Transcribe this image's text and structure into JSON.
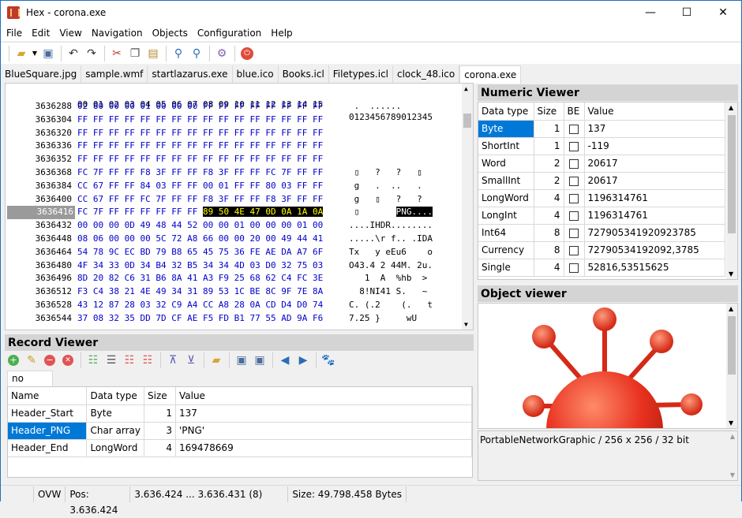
{
  "window": {
    "title": "Hex - corona.exe",
    "minimize": "—",
    "maximize": "☐",
    "close": "✕"
  },
  "menu": [
    "File",
    "Edit",
    "View",
    "Navigation",
    "Objects",
    "Configuration",
    "Help"
  ],
  "toolbar_icons": [
    "open-folder-icon",
    "dropdown-arrow-icon",
    "save-icon",
    "undo-icon",
    "redo-icon",
    "cut-icon",
    "copy-icon",
    "paste-icon",
    "find-icon",
    "find-next-icon",
    "settings-icon",
    "power-icon"
  ],
  "tabs": [
    "BlueSquare.jpg",
    "sample.wmf",
    "startlazarus.exe",
    "blue.ico",
    "Books.icl",
    "Filetypes.icl",
    "clock_48.ico",
    "corona.exe"
  ],
  "active_tab": "corona.exe",
  "hex": {
    "header_cols": "00 01 02 03 04 05 06 07 08 09 10 11 12 13 14 15",
    "header_ascii": "0123456789012345",
    "rows": [
      {
        "off": "3636288",
        "hex": "02 80 00 00 01 00 00 00 FF FF FF FF FF FF FF FF",
        "asc": " .  ......"
      },
      {
        "off": "3636304",
        "hex": "FF FF FF FF FF FF FF FF FF FF FF FF FF FF FF FF",
        "asc": ""
      },
      {
        "off": "3636320",
        "hex": "FF FF FF FF FF FF FF FF FF FF FF FF FF FF FF FF",
        "asc": ""
      },
      {
        "off": "3636336",
        "hex": "FF FF FF FF FF FF FF FF FF FF FF FF FF FF FF FF",
        "asc": ""
      },
      {
        "off": "3636352",
        "hex": "FF FF FF FF FF FF FF FF FF FF FF FF FF FF FF FF",
        "asc": ""
      },
      {
        "off": "3636368",
        "hex": "FC 7F FF FF F8 3F FF FF F8 3F FF FF FC 7F FF FF",
        "asc": " ▯   ?   ?   ▯"
      },
      {
        "off": "3636384",
        "hex": "CC 67 FF FF 84 03 FF FF 00 01 FF FF 80 03 FF FF",
        "asc": " g   .  ..   ."
      },
      {
        "off": "3636400",
        "hex": "CC 67 FF FF FC 7F FF FF F8 3F FF FF F8 3F FF FF",
        "asc": " g   ▯   ?   ?"
      },
      {
        "off": "3636416",
        "hex": "FC 7F FF FF FF FF FF FF 89 50 4E 47 0D 0A 1A 0A",
        "asc": " ▯       PNG....",
        "selected": true
      },
      {
        "off": "3636432",
        "hex": "00 00 00 0D 49 48 44 52 00 00 01 00 00 00 01 00",
        "asc": "....IHDR........"
      },
      {
        "off": "3636448",
        "hex": "08 06 00 00 00 5C 72 A8 66 00 00 20 00 49 44 41",
        "asc": ".....\\r f.. .IDA"
      },
      {
        "off": "3636464",
        "hex": "54 78 9C EC BD 79 B8 65 45 75 36 FE AE DA A7 6F",
        "asc": "Tx   y eEu6    o"
      },
      {
        "off": "3636480",
        "hex": "4F 34 33 0D 34 B4 32 B5 34 34 4D 03 D0 32 75 03",
        "asc": "O43.4 2 44M. 2u."
      },
      {
        "off": "3636496",
        "hex": "8D 20 82 C6 31 B6 8A 41 A3 F9 25 68 62 C4 FC 3E",
        "asc": "   1  A  %hb  >"
      },
      {
        "off": "3636512",
        "hex": "F3 C4 38 21 4E 49 34 31 89 53 1C BE 8C 9F 7E 8A",
        "asc": "  8!NI41 S.   ~"
      },
      {
        "off": "3636528",
        "hex": "43 12 87 28 03 32 C9 A4 CC A8 28 0A CD D4 D0 74",
        "asc": "C. (.2    (.   t"
      },
      {
        "off": "3636544",
        "hex": "37 08 32 35 DD 7D CF AE F5 FD B1 77 55 AD 9A F6",
        "asc": "7.25 }     wU"
      }
    ]
  },
  "record_viewer": {
    "title": "Record Viewer",
    "tab": "no name",
    "columns": [
      "Name",
      "Data type",
      "Size",
      "Value"
    ],
    "rows": [
      {
        "name": "Header_Start",
        "type": "Byte",
        "size": "1",
        "value": "137"
      },
      {
        "name": "Header_PNG",
        "type": "Char array",
        "size": "3",
        "value": "'PNG'"
      },
      {
        "name": "Header_End",
        "type": "LongWord",
        "size": "4",
        "value": "169478669"
      }
    ]
  },
  "numeric_viewer": {
    "title": "Numeric Viewer",
    "columns": [
      "Data type",
      "Size",
      "BE",
      "Value"
    ],
    "rows": [
      {
        "type": "Byte",
        "size": "1",
        "value": "137"
      },
      {
        "type": "ShortInt",
        "size": "1",
        "value": "-119"
      },
      {
        "type": "Word",
        "size": "2",
        "value": "20617"
      },
      {
        "type": "SmallInt",
        "size": "2",
        "value": "20617"
      },
      {
        "type": "LongWord",
        "size": "4",
        "value": "1196314761"
      },
      {
        "type": "LongInt",
        "size": "4",
        "value": "1196314761"
      },
      {
        "type": "Int64",
        "size": "8",
        "value": "727905341920923785"
      },
      {
        "type": "Currency",
        "size": "8",
        "value": "72790534192092,3785"
      },
      {
        "type": "Single",
        "size": "4",
        "value": "52816,53515625"
      }
    ]
  },
  "object_viewer": {
    "title": "Object viewer",
    "info": "PortableNetworkGraphic / 256 x 256 / 32 bit"
  },
  "status": {
    "mode": "OVW",
    "pos": "Pos: 3.636.424",
    "sel": "3.636.424 ... 3.636.431 (8)",
    "size": "Size: 49.798.458 Bytes"
  },
  "colors": {
    "hex_text": "#0000cc",
    "selection": "#0078d7",
    "virus": "#e8321f"
  }
}
